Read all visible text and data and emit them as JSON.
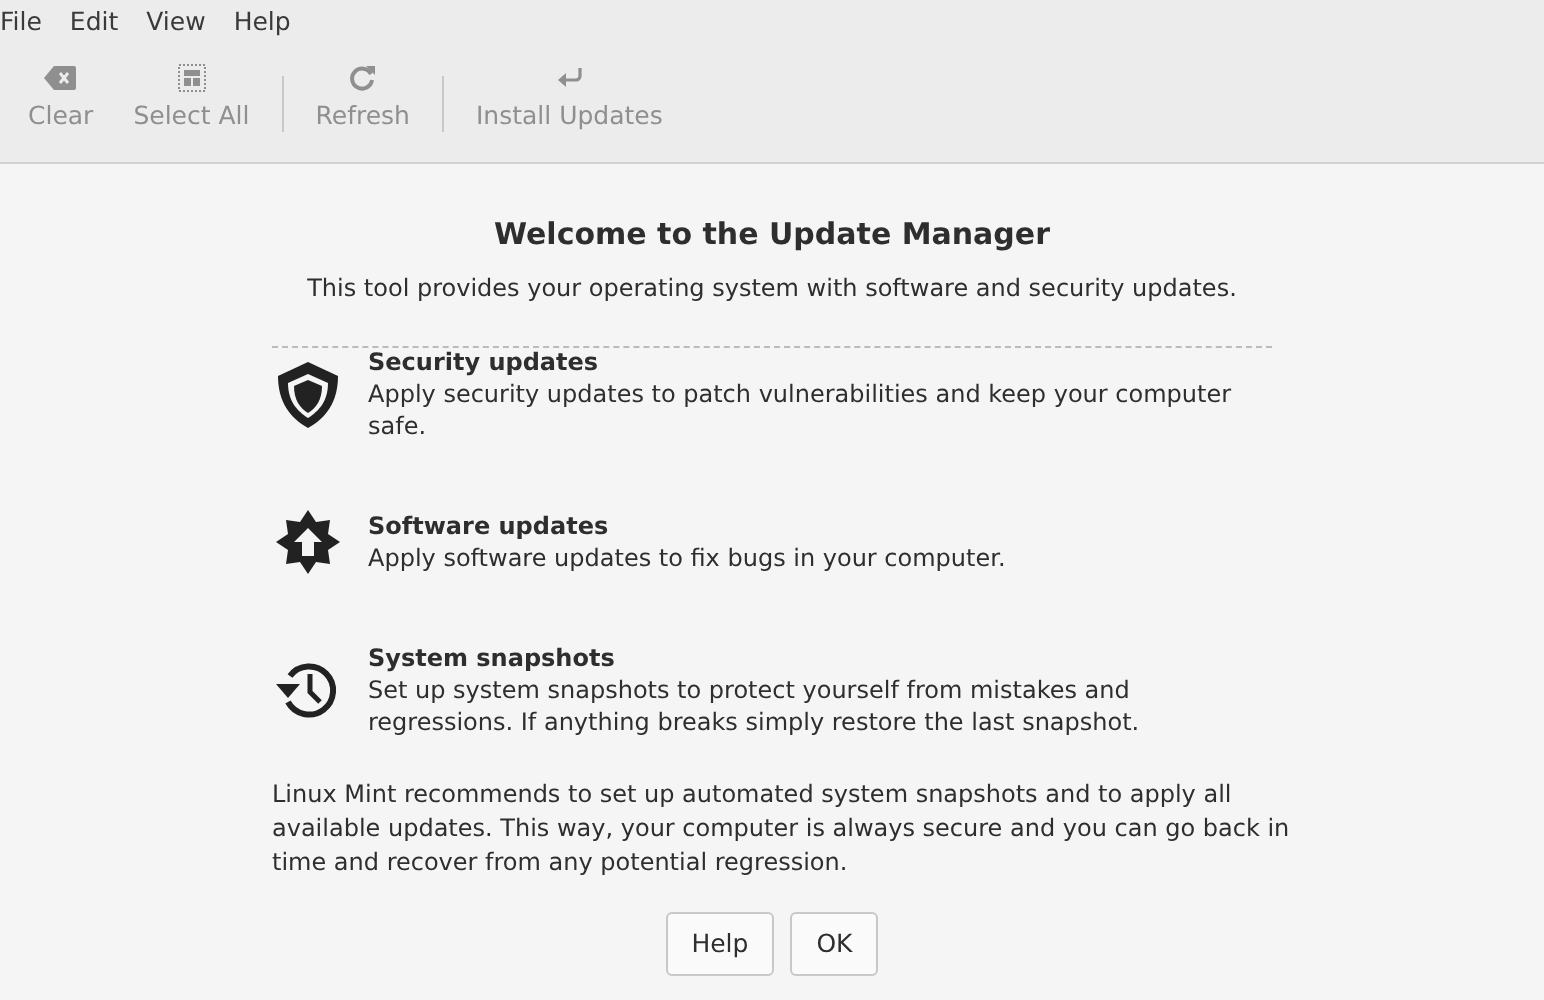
{
  "menu": [
    {
      "label": "File"
    },
    {
      "label": "Edit"
    },
    {
      "label": "View"
    },
    {
      "label": "Help"
    }
  ],
  "toolbar": [
    {
      "kind": "button",
      "label": "Clear",
      "disabled": true
    },
    {
      "kind": "button",
      "label": "Select All",
      "disabled": true
    },
    {
      "kind": "separator"
    },
    {
      "kind": "button",
      "label": "Refresh",
      "disabled": true
    },
    {
      "kind": "separator"
    },
    {
      "kind": "button",
      "label": "Install Updates",
      "disabled": true
    }
  ],
  "welcome": {
    "title": "Welcome to the Update Manager",
    "subtitle": "This tool provides your operating system with software and security updates.",
    "features": [
      {
        "title": "Security updates",
        "text": "Apply security updates to patch vulnerabilities and keep your computer safe."
      },
      {
        "title": "Software updates",
        "text": "Apply software updates to fix bugs in your computer."
      },
      {
        "title": "System snapshots",
        "text": "Set up system snapshots to protect yourself from mistakes and regressions. If anything breaks simply restore the last snapshot."
      }
    ],
    "recommendation": "Linux Mint recommends to set up automated system snapshots and to apply all available updates. This way, your computer is always secure and you can go back in time and recover from any potential regression.",
    "buttons": [
      {
        "label": "Help"
      },
      {
        "label": "OK"
      }
    ]
  }
}
